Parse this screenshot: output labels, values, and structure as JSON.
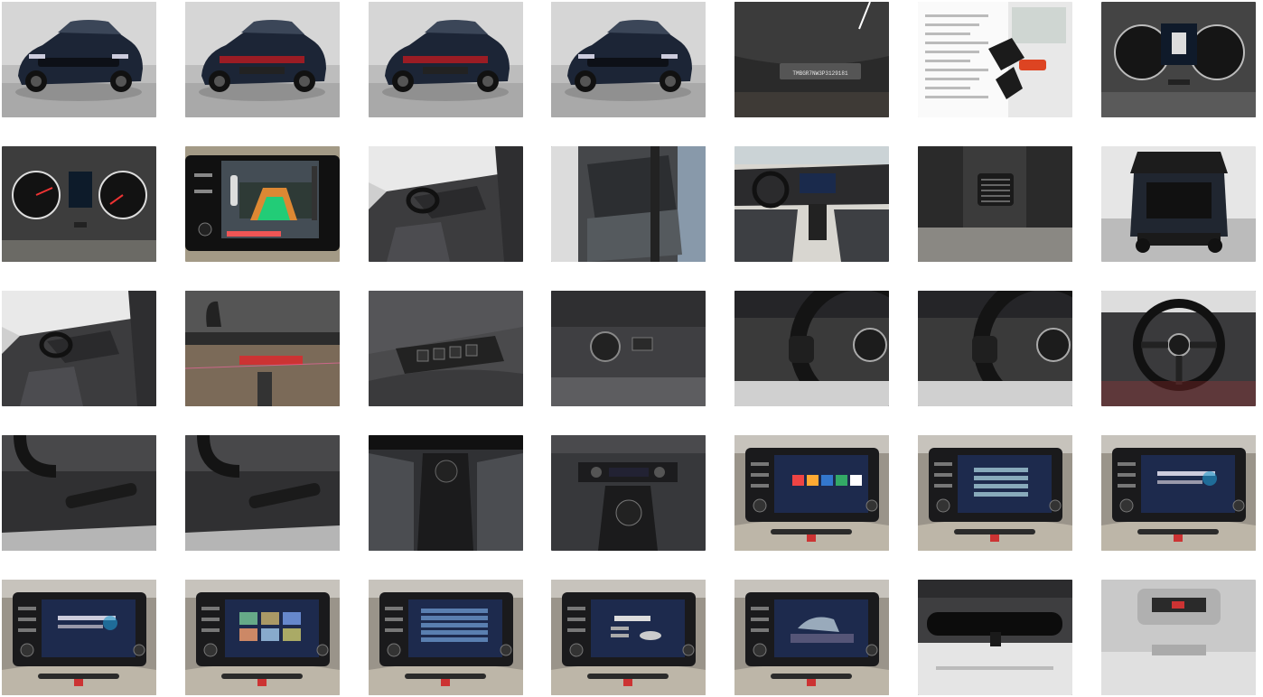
{
  "gallery": {
    "items": [
      {
        "kind": "car-front-studio",
        "color": "#1c2536"
      },
      {
        "kind": "car-rear-studio",
        "color": "#1c2536"
      },
      {
        "kind": "car-rear-studio",
        "color": "#1c2536"
      },
      {
        "kind": "car-front-studio",
        "color": "#1c2536"
      },
      {
        "kind": "vin-plate",
        "text": "TMBGR7NW3P3129181"
      },
      {
        "kind": "documents-keys"
      },
      {
        "kind": "cluster-digital"
      },
      {
        "kind": "cluster-analog"
      },
      {
        "kind": "rear-camera-screen"
      },
      {
        "kind": "interior-front-open-door"
      },
      {
        "kind": "interior-rear-seats"
      },
      {
        "kind": "dashboard-wide"
      },
      {
        "kind": "rear-vent"
      },
      {
        "kind": "trunk-open"
      },
      {
        "kind": "interior-front-open-door"
      },
      {
        "kind": "tow-hitch"
      },
      {
        "kind": "window-switches"
      },
      {
        "kind": "light-switch"
      },
      {
        "kind": "steering-wheel-close"
      },
      {
        "kind": "steering-wheel-close"
      },
      {
        "kind": "steering-wheel-full"
      },
      {
        "kind": "stalk-close"
      },
      {
        "kind": "stalk-close"
      },
      {
        "kind": "gear-stick"
      },
      {
        "kind": "gear-climate"
      },
      {
        "kind": "infotainment-screen",
        "variant": "apps"
      },
      {
        "kind": "infotainment-screen",
        "variant": "list"
      },
      {
        "kind": "infotainment-screen",
        "variant": "message"
      },
      {
        "kind": "infotainment-screen",
        "variant": "message"
      },
      {
        "kind": "infotainment-screen",
        "variant": "tiles"
      },
      {
        "kind": "infotainment-screen",
        "variant": "settings"
      },
      {
        "kind": "infotainment-screen",
        "variant": "trip"
      },
      {
        "kind": "infotainment-screen",
        "variant": "car"
      },
      {
        "kind": "rear-mirror"
      },
      {
        "kind": "overhead-console"
      }
    ]
  }
}
